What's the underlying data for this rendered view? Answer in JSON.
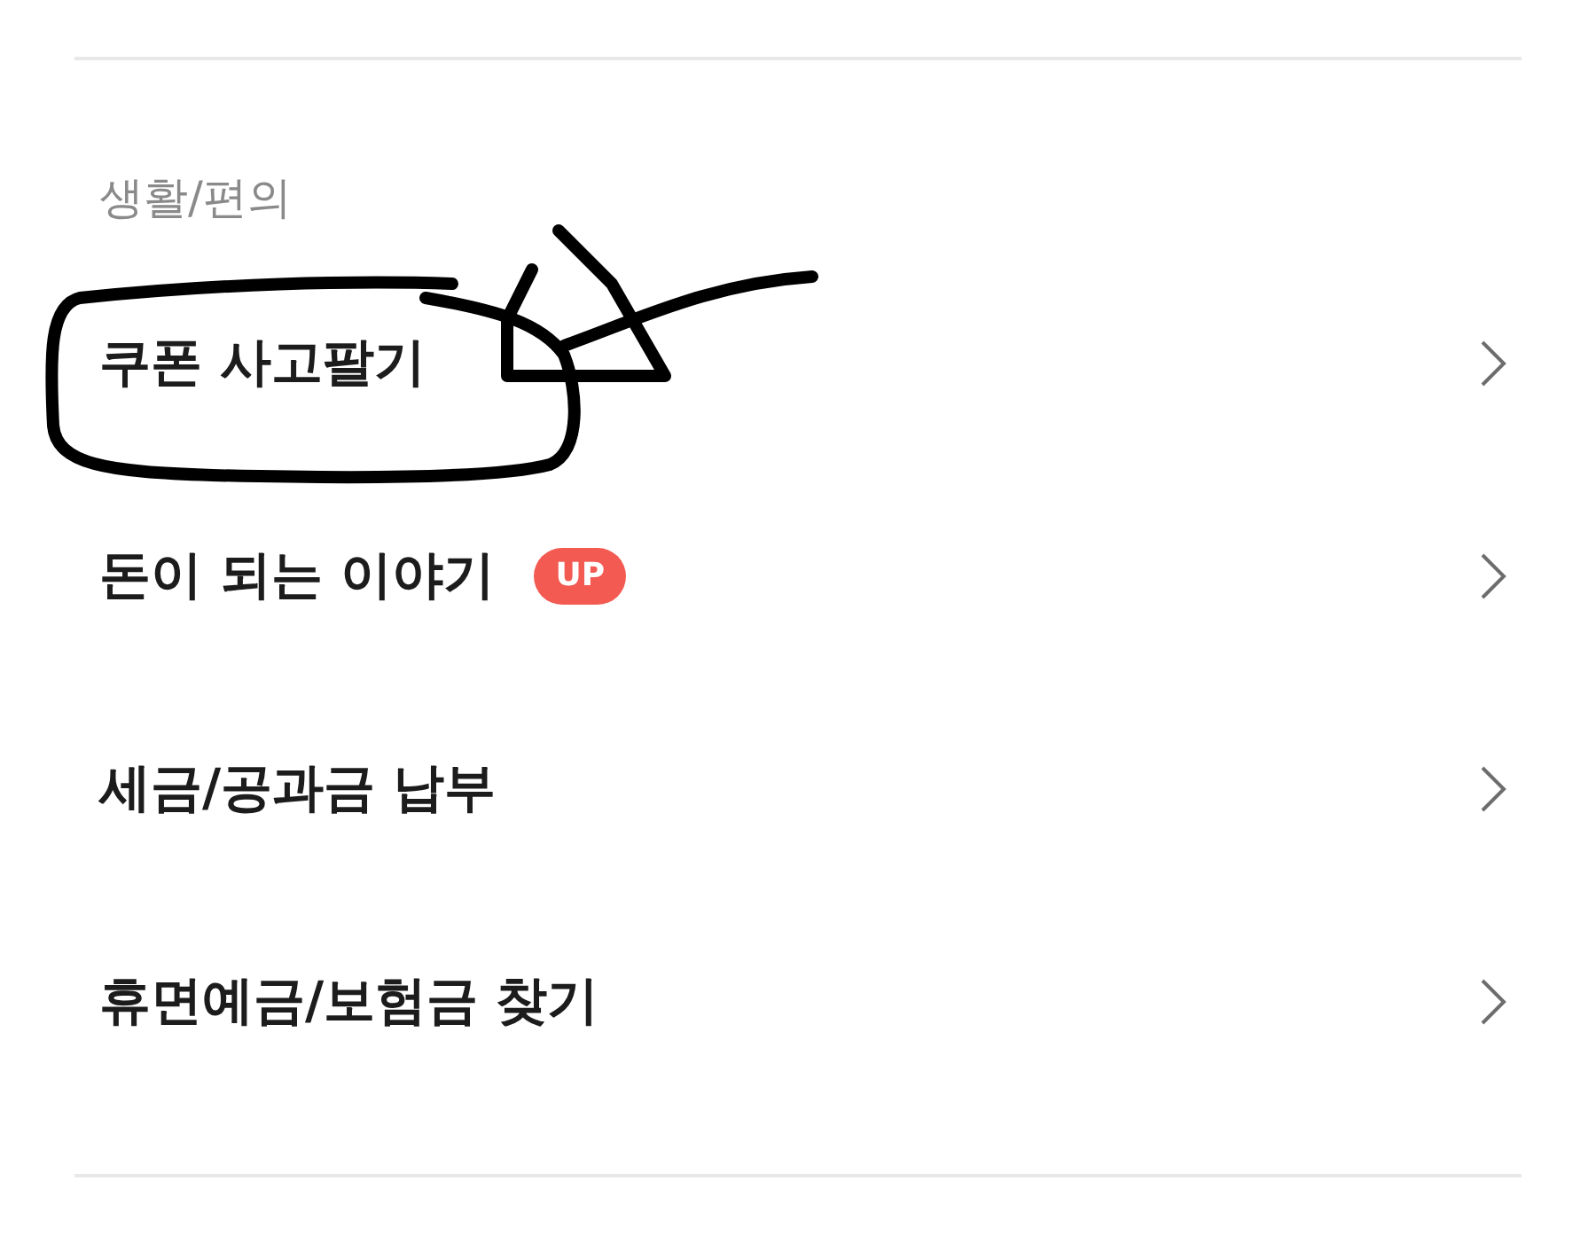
{
  "section": {
    "title": "생활/편의"
  },
  "items": [
    {
      "label": "쿠폰 사고팔기"
    },
    {
      "label": "돈이 되는 이야기",
      "badge": "UP"
    },
    {
      "label": "세금/공과금 납부"
    },
    {
      "label": "휴면예금/보험금 찾기"
    }
  ],
  "annotation": {
    "kind": "scribble"
  }
}
